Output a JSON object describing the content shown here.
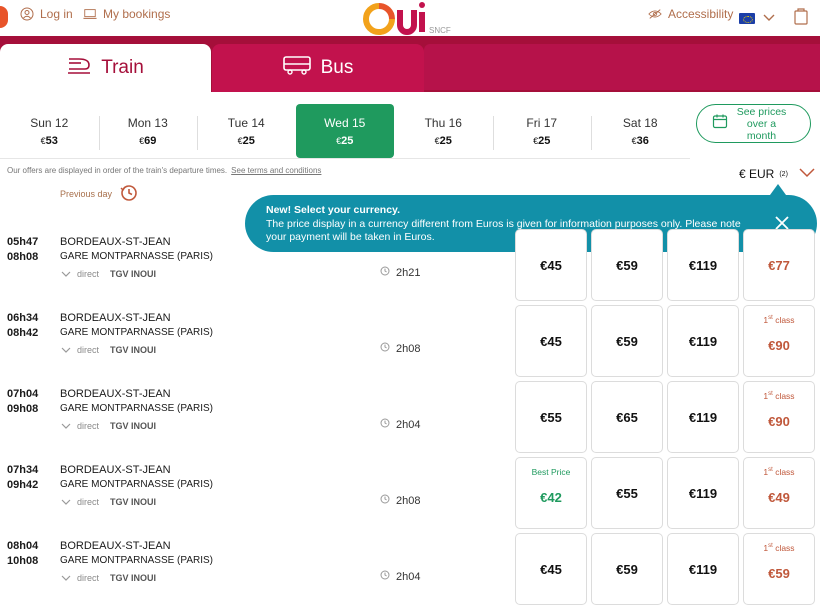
{
  "header": {
    "login": "Log in",
    "bookings": "My bookings",
    "logo_text": "Oui",
    "logo_sub": "SNCF",
    "accessibility": "Accessibility"
  },
  "tabs": [
    {
      "label": "Train",
      "active": true
    },
    {
      "label": "Bus",
      "active": false
    }
  ],
  "dates": [
    {
      "day": "Sun 12",
      "price": "53"
    },
    {
      "day": "Mon 13",
      "price": "69"
    },
    {
      "day": "Tue 14",
      "price": "25"
    },
    {
      "day": "Wed 15",
      "price": "25",
      "active": true
    },
    {
      "day": "Thu 16",
      "price": "25"
    },
    {
      "day": "Fri 17",
      "price": "25"
    },
    {
      "day": "Sat 18",
      "price": "36"
    }
  ],
  "currency_symbol": "€",
  "see_month": "See prices over a month",
  "notice": "Our offers are displayed in order of the train's departure times.",
  "terms": "See terms and conditions",
  "currency": {
    "label": "€ EUR",
    "note": "(2)"
  },
  "previous_day": "Previous day",
  "tooltip": {
    "title": "New! Select your currency.",
    "body": "The price display in a currency different from Euros is given for information purposes only. Please note your payment will be taken in Euros."
  },
  "first_class_label": "1st class",
  "best_price_label": "Best Price",
  "colors": {
    "brand": "#a50f3a",
    "accent_green": "#1f9a5e",
    "tooltip": "#1290a8",
    "first_class": "#c0583b"
  },
  "trains": [
    {
      "dep": "05h47",
      "arr": "08h08",
      "from": "BORDEAUX-ST-JEAN",
      "to": "GARE MONTPARNASSE (PARIS)",
      "type": "direct",
      "brand": "TGV INOUI",
      "duration": "2h21",
      "prices": [
        "€45",
        "€59",
        "€119",
        "€77"
      ],
      "first_label_visible": false,
      "best": null
    },
    {
      "dep": "06h34",
      "arr": "08h42",
      "from": "BORDEAUX-ST-JEAN",
      "to": "GARE MONTPARNASSE (PARIS)",
      "type": "direct",
      "brand": "TGV INOUI",
      "duration": "2h08",
      "prices": [
        "€45",
        "€59",
        "€119",
        "€90"
      ],
      "first_label_visible": true,
      "best": null
    },
    {
      "dep": "07h04",
      "arr": "09h08",
      "from": "BORDEAUX-ST-JEAN",
      "to": "GARE MONTPARNASSE (PARIS)",
      "type": "direct",
      "brand": "TGV INOUI",
      "duration": "2h04",
      "prices": [
        "€55",
        "€65",
        "€119",
        "€90"
      ],
      "first_label_visible": true,
      "best": null
    },
    {
      "dep": "07h34",
      "arr": "09h42",
      "from": "BORDEAUX-ST-JEAN",
      "to": "GARE MONTPARNASSE (PARIS)",
      "type": "direct",
      "brand": "TGV INOUI",
      "duration": "2h08",
      "prices": [
        "€42",
        "€55",
        "€119",
        "€49"
      ],
      "first_label_visible": true,
      "best": 0
    },
    {
      "dep": "08h04",
      "arr": "10h08",
      "from": "BORDEAUX-ST-JEAN",
      "to": "GARE MONTPARNASSE (PARIS)",
      "type": "direct",
      "brand": "TGV INOUI",
      "duration": "2h04",
      "prices": [
        "€45",
        "€59",
        "€119",
        "€59"
      ],
      "first_label_visible": true,
      "best": null
    }
  ]
}
